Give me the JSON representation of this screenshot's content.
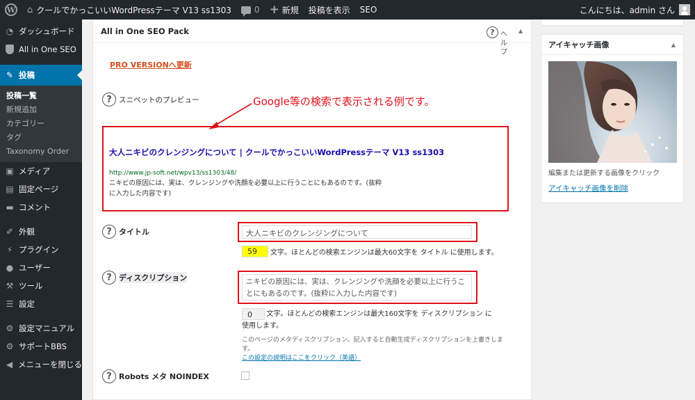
{
  "adminbar": {
    "site_title": "クールでかっこいいWordPressテーマ V13 ss1303",
    "comments_count": "0",
    "new_label": "新規",
    "view_post_label": "投稿を表示",
    "seo_label": "SEO",
    "greeting": "こんにちは、admin さん"
  },
  "sidebar": {
    "dashboard": "ダッシュボード",
    "aioseo": "All in One SEO",
    "posts": "投稿",
    "sub_all_posts": "投稿一覧",
    "sub_add_new": "新規追加",
    "sub_categories": "カテゴリー",
    "sub_tags": "タグ",
    "sub_taxonomy_order": "Taxonomy Order",
    "media": "メディア",
    "pages": "固定ページ",
    "comments": "コメント",
    "appearance": "外観",
    "plugins": "プラグイン",
    "users": "ユーザー",
    "tools": "ツール",
    "settings": "設定",
    "settings_manual": "設定マニュアル",
    "support_bbs": "サポートBBS",
    "collapse_menu": "メニューを閉じる"
  },
  "seo_pack": {
    "title": "All in One SEO Pack",
    "help_label": "ヘルプ",
    "pro_link": "PRO VERSIONへ更新",
    "snippet_label": "スニペットのプレビュー",
    "annotation": "Google等の検索で表示される例です。",
    "snippet_title": "大人ニキビのクレンジングについて | クールでかっこいいWordPressテーマ V13 ss1303",
    "snippet_url": "http://www.jp-soft.net/wpv13/ss1303/48/",
    "snippet_desc_1": "ニキビの原因には、実は、クレンジングや洗顔を必要以上に行うことにもあるのです。(抜粋",
    "snippet_desc_2": "に入力した内容です)",
    "title_label": "タイトル",
    "title_value": "大人ニキビのクレンジングについて",
    "title_count": "59",
    "title_hint": "文字。ほとんどの検索エンジンは最大60文字を タイトル に使用します。",
    "desc_label": "ディスクリプション",
    "desc_value": "ニキビの原因には、実は、クレンジングや洗顔を必要以上に行うことにもあるのです。(抜粋に入力した内容です)",
    "desc_count": "0",
    "desc_hint_1": "文字。ほとんどの検索エンジンは最大160文字を ディスクリプション に",
    "desc_hint_2": "使用します。",
    "desc_note_1": "このページのメタディスクリプション。記入すると自動生成ディスクリプションを上書きしま",
    "desc_note_2": "す。",
    "desc_help_link": "この設定の説明はここをクリック（英語）",
    "noindex_label": "Robots メタ NOINDEX"
  },
  "featured_image": {
    "title": "アイキャッチ画像",
    "hint": "編集または更新する画像をクリック",
    "remove_link": "アイキャッチ画像を削除"
  },
  "colors": {
    "adminbar_bg": "#23282d",
    "current_menu": "#0073aa",
    "annotation_red": "#e0101a",
    "snippet_title": "#1a0dab",
    "snippet_url": "#006621",
    "pro_link": "#d54e21",
    "count_highlight": "#ffff00"
  }
}
